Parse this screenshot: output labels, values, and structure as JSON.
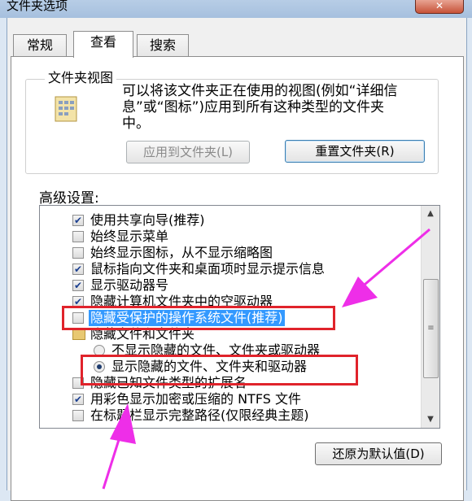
{
  "window": {
    "title": "文件夹选项",
    "close_glyph": "✕"
  },
  "tabs": [
    {
      "label": "常规"
    },
    {
      "label": "查看"
    },
    {
      "label": "搜索"
    }
  ],
  "folder_views": {
    "group_label": "文件夹视图",
    "description": "可以将该文件夹正在使用的视图(例如“详细信\n息”或“图标”)应用到所有这种类型的文件夹\n中。",
    "apply_button": "应用到文件夹(L)",
    "reset_button": "重置文件夹(R)"
  },
  "advanced": {
    "label": "高级设置:",
    "items": [
      {
        "text": "使用共享向导(推荐)",
        "control": "checkbox",
        "checked": true
      },
      {
        "text": "始终显示菜单",
        "control": "checkbox",
        "checked": false
      },
      {
        "text": "始终显示图标，从不显示缩略图",
        "control": "checkbox",
        "checked": false
      },
      {
        "text": "鼠标指向文件夹和桌面项时显示提示信息",
        "control": "checkbox",
        "checked": true
      },
      {
        "text": "显示驱动器号",
        "control": "checkbox",
        "checked": true
      },
      {
        "text": "隐藏计算机文件夹中的空驱动器",
        "control": "checkbox",
        "checked": true
      },
      {
        "text": "隐藏受保护的操作系统文件(推荐)",
        "control": "checkbox",
        "checked": false
      },
      {
        "text": "隐藏文件和文件夹",
        "control": "folder"
      },
      {
        "text": "不显示隐藏的文件、文件夹或驱动器",
        "control": "radio",
        "checked": false
      },
      {
        "text": "显示隐藏的文件、文件夹和驱动器",
        "control": "radio",
        "checked": true
      },
      {
        "text": "隐藏已知文件类型的扩展名",
        "control": "checkbox",
        "checked": false
      },
      {
        "text": "用彩色显示加密或压缩的 NTFS 文件",
        "control": "checkbox",
        "checked": true
      },
      {
        "text": "在标题栏显示完整路径(仅限经典主题)",
        "control": "checkbox",
        "checked": false
      }
    ],
    "restore_button": "还原为默认值(D)"
  },
  "scrollbar": {
    "up_glyph": "▲",
    "down_glyph": "▼",
    "grip_glyph": "≡"
  },
  "colors": {
    "annotation_box": "#e0232b",
    "annotation_arrow": "#ee2ee8",
    "selection": "#3399ff"
  }
}
